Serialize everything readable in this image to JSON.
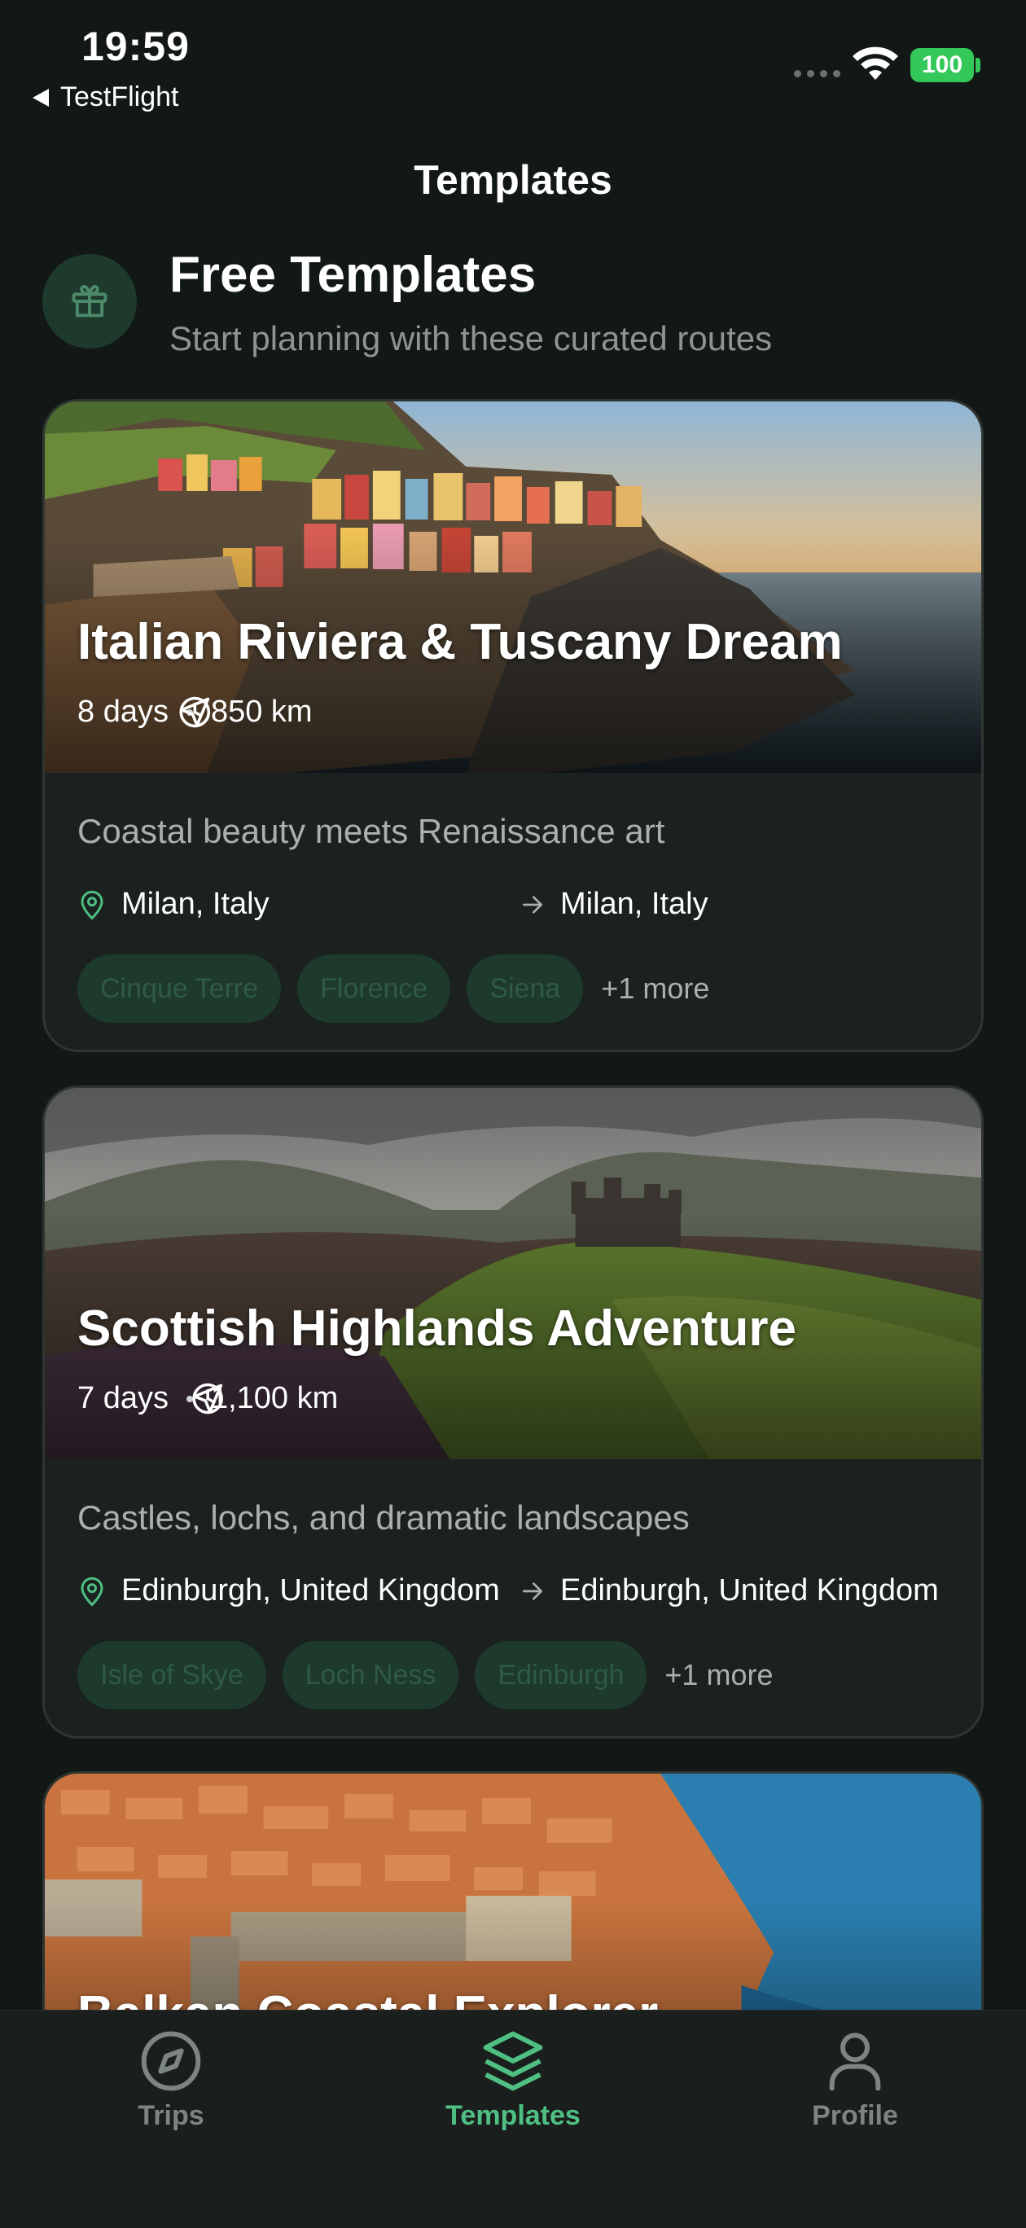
{
  "status_bar": {
    "time": "19:59",
    "back_app": "TestFlight",
    "battery": "100"
  },
  "nav": {
    "title": "Templates"
  },
  "section": {
    "icon": "gift-icon",
    "title": "Free Templates",
    "subtitle": "Start planning with these curated routes"
  },
  "templates": [
    {
      "title": "Italian Riviera & Tuscany Dream",
      "duration": "8 days",
      "distance": "850 km",
      "description": "Coastal beauty meets Renaissance art",
      "from": "Milan, Italy",
      "to": "Milan, Italy",
      "tags": [
        "Cinque Terre",
        "Florence",
        "Siena"
      ],
      "more": "+1 more"
    },
    {
      "title": "Scottish Highlands Adventure",
      "duration": "7 days",
      "distance": "1,100 km",
      "description": "Castles, lochs, and dramatic landscapes",
      "from": "Edinburgh, United Kingdom",
      "to": "Edinburgh, United Kingdom",
      "tags": [
        "Isle of Skye",
        "Loch Ness",
        "Edinburgh"
      ],
      "more": "+1 more"
    },
    {
      "title": "Balkan Coastal Explorer"
    }
  ],
  "tab_bar": {
    "items": [
      {
        "label": "Trips",
        "icon": "compass-icon",
        "active": false
      },
      {
        "label": "Templates",
        "icon": "layers-icon",
        "active": true
      },
      {
        "label": "Profile",
        "icon": "person-icon",
        "active": false
      }
    ]
  },
  "colors": {
    "background": "#111816",
    "accent": "#4fbf83",
    "card": "#1a211f",
    "tag_bg": "#1d3a2c"
  }
}
